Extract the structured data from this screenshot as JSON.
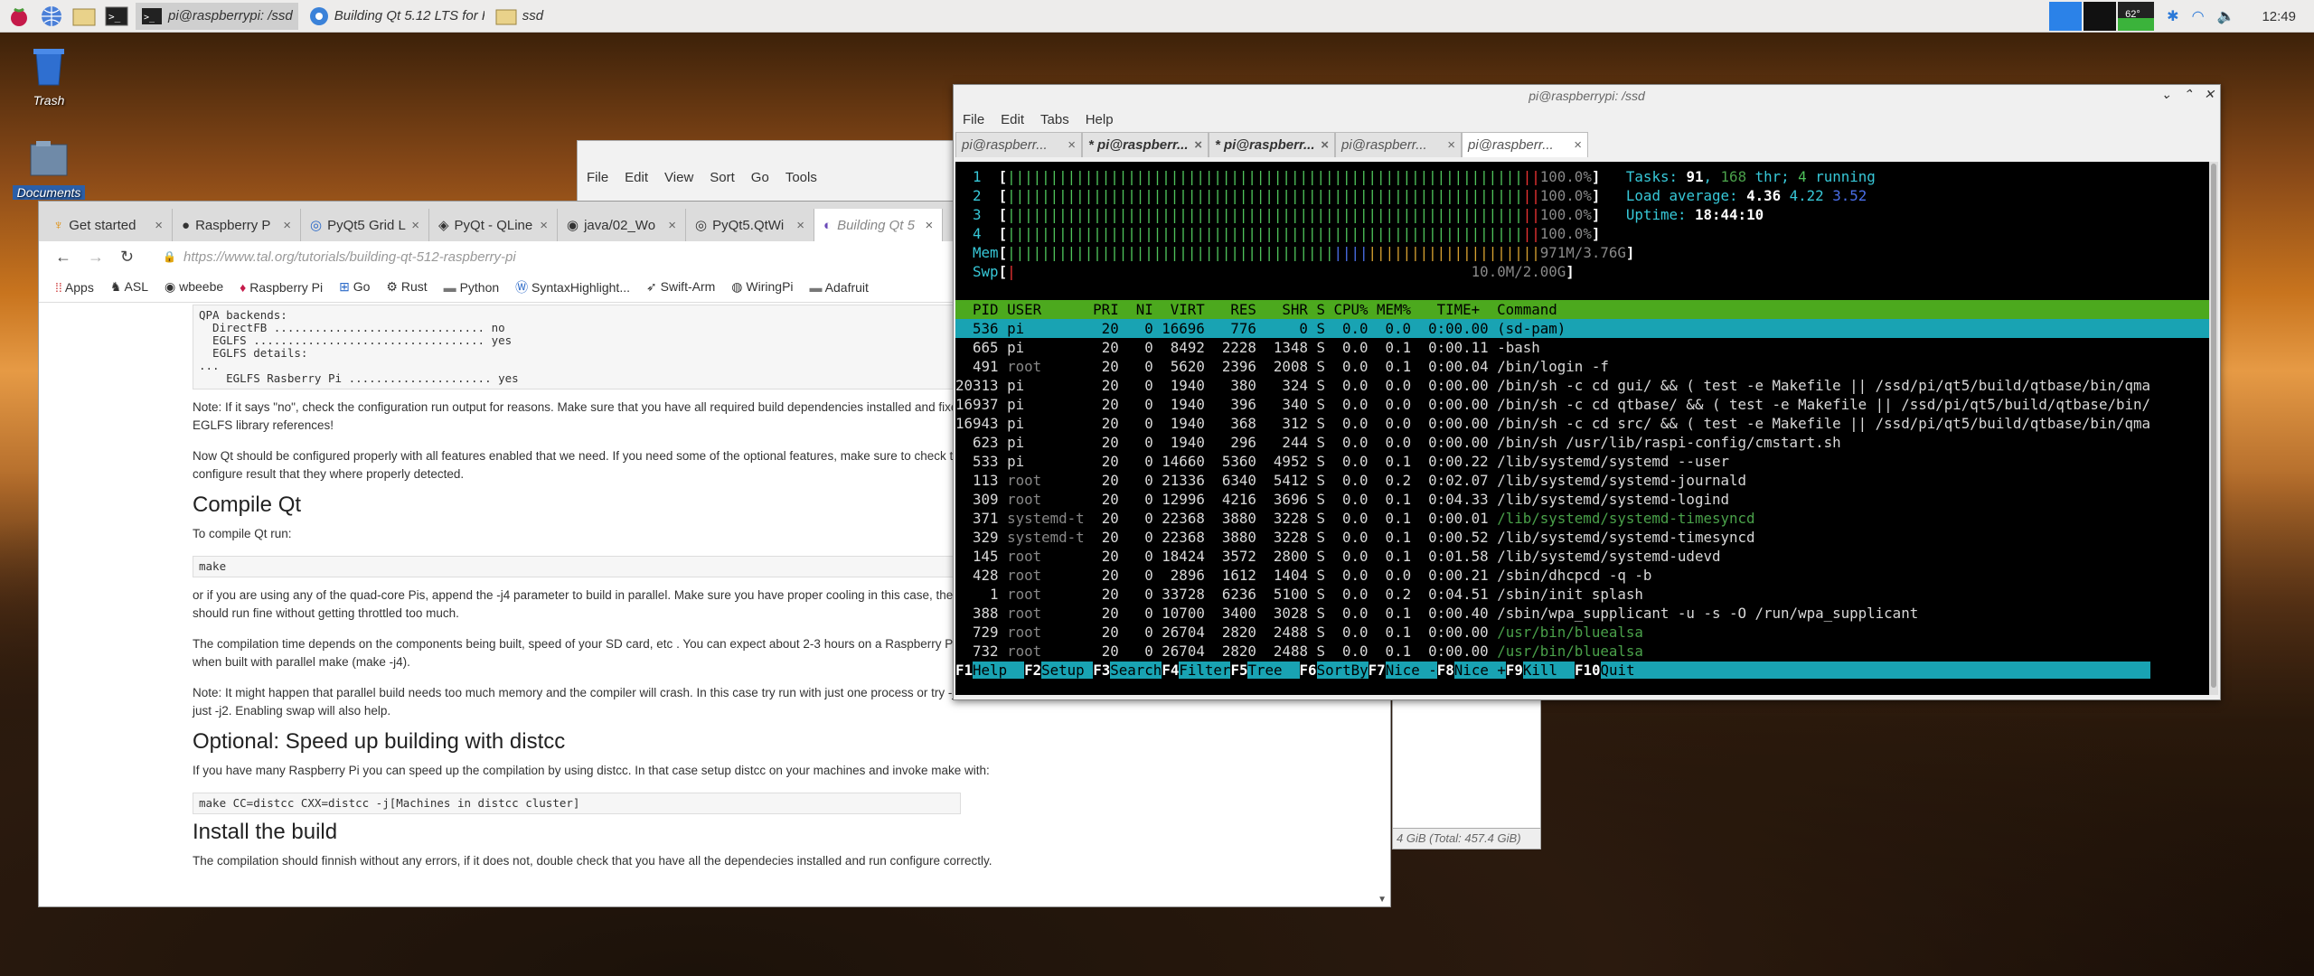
{
  "taskbar": {
    "tasks": [
      {
        "label": "pi@raspberrypi: /ssd",
        "icon": "terminal-icon"
      },
      {
        "label": "Building Qt 5.12 LTS for R...",
        "icon": "chromium-icon"
      },
      {
        "label": "ssd",
        "icon": "folder-icon"
      }
    ],
    "cpu": "62°",
    "clock": "12:49"
  },
  "desktop": {
    "icons": [
      {
        "label": "Trash"
      },
      {
        "label": "Documents"
      }
    ]
  },
  "filemanager": {
    "menu": [
      "File",
      "Edit",
      "View",
      "Sort",
      "Go",
      "Tools"
    ],
    "status": "4 GiB (Total: 457.4 GiB)"
  },
  "browser": {
    "tabs": [
      "Get started",
      "Raspberry P",
      "PyQt5 Grid L",
      "PyQt - QLine",
      "java/02_Wo",
      "PyQt5.QtWi",
      "Building Qt 5"
    ],
    "url": "https://www.tal.org/tutorials/building-qt-512-raspberry-pi",
    "bookmarks": [
      "Apps",
      "ASL",
      "wbeebe",
      "Raspberry Pi",
      "Go",
      "Rust",
      "Python",
      "SyntaxHighlight...",
      "Swift-Arm",
      "WiringPi",
      "Adafruit"
    ],
    "code1": "QPA backends:\n  DirectFB ............................... no\n  EGLFS .................................. yes\n  EGLFS details:\n...\n    EGLFS Rasberry Pi ..................... yes",
    "p1": "Note: If it says \"no\", check the configuration run output for reasons. Make sure that you have all required build dependencies installed and fixed the EGLFS library references!",
    "p2": "Now Qt should be configured properly with all features enabled that we need. If you need some of the optional features, make sure to check the configure result that they where properly detected.",
    "h_compile": "Compile Qt",
    "p3": "To compile Qt run:",
    "code2": "make",
    "p4": "or if you are using any of the quad-core Pis, append the -j4 parameter to build in parallel. Make sure you have proper cooling in this case, the 3+ this should run fine without getting throttled too much.",
    "p5": "The compilation time depends on the components being built, speed of your SD card, etc . You can expect about 2-3 hours on a Raspberry Pi 3 when built with parallel make (make -j4).",
    "p6": "Note: It might happen that parallel build needs too much memory and the compiler will crash. In this case try run with just one process or try -j3 or just -j2. Enabling swap will also help.",
    "h_distcc": "Optional: Speed up building with distcc",
    "p7": "If you have many Raspberry Pi you can speed up the compilation by using distcc. In that case setup distcc on your machines and invoke make with:",
    "code3": "make CC=distcc CXX=distcc -j[Machines in distcc cluster]",
    "h_install": "Install the build",
    "p8": "The compilation should finnish without any errors, if it does not, double check that you have all the dependecies installed and run configure correctly."
  },
  "terminal": {
    "title": "pi@raspberrypi: /ssd",
    "menu": [
      "File",
      "Edit",
      "Tabs",
      "Help"
    ],
    "tabs": [
      "pi@raspberr...",
      "* pi@raspberr...",
      "* pi@raspberr...",
      "pi@raspberr...",
      "pi@raspberr..."
    ],
    "cpu_rows": [
      {
        "n": "1",
        "pct": "100.0%"
      },
      {
        "n": "2",
        "pct": "100.0%"
      },
      {
        "n": "3",
        "pct": "100.0%"
      },
      {
        "n": "4",
        "pct": "100.0%"
      }
    ],
    "mem": "971M/3.76G",
    "swp": "10.0M/2.00G",
    "tasks": "91",
    "thr": "168",
    "running": "4",
    "load": [
      "4.36",
      "4.22",
      "3.52"
    ],
    "uptime": "18:44:10",
    "header": "  PID USER      PRI  NI  VIRT   RES   SHR S CPU% MEM%   TIME+  Command",
    "procs": [
      {
        "pid": "536",
        "user": "pi",
        "virt": "16696",
        "res": "776",
        "shr": "0",
        "cpu": "0.0",
        "mem": "0.0",
        "time": "0:00.00",
        "cmd": "(sd-pam)"
      },
      {
        "pid": "665",
        "user": "pi",
        "virt": "8492",
        "res": "2228",
        "shr": "1348",
        "cpu": "0.0",
        "mem": "0.1",
        "time": "0:00.11",
        "cmd": "-bash"
      },
      {
        "pid": "491",
        "user": "root",
        "virt": "5620",
        "res": "2396",
        "shr": "2008",
        "cpu": "0.0",
        "mem": "0.1",
        "time": "0:00.04",
        "cmd": "/bin/login -f"
      },
      {
        "pid": "20313",
        "user": "pi",
        "virt": "1940",
        "res": "380",
        "shr": "324",
        "cpu": "0.0",
        "mem": "0.0",
        "time": "0:00.00",
        "cmd": "/bin/sh -c cd gui/ && ( test -e Makefile || /ssd/pi/qt5/build/qtbase/bin/qma"
      },
      {
        "pid": "16937",
        "user": "pi",
        "virt": "1940",
        "res": "396",
        "shr": "340",
        "cpu": "0.0",
        "mem": "0.0",
        "time": "0:00.00",
        "cmd": "/bin/sh -c cd qtbase/ && ( test -e Makefile || /ssd/pi/qt5/build/qtbase/bin/"
      },
      {
        "pid": "16943",
        "user": "pi",
        "virt": "1940",
        "res": "368",
        "shr": "312",
        "cpu": "0.0",
        "mem": "0.0",
        "time": "0:00.00",
        "cmd": "/bin/sh -c cd src/ && ( test -e Makefile || /ssd/pi/qt5/build/qtbase/bin/qma"
      },
      {
        "pid": "623",
        "user": "pi",
        "virt": "1940",
        "res": "296",
        "shr": "244",
        "cpu": "0.0",
        "mem": "0.0",
        "time": "0:00.00",
        "cmd": "/bin/sh /usr/lib/raspi-config/cmstart.sh"
      },
      {
        "pid": "533",
        "user": "pi",
        "virt": "14660",
        "res": "5360",
        "shr": "4952",
        "cpu": "0.0",
        "mem": "0.1",
        "time": "0:00.22",
        "cmd": "/lib/systemd/systemd --user"
      },
      {
        "pid": "113",
        "user": "root",
        "virt": "21336",
        "res": "6340",
        "shr": "5412",
        "cpu": "0.0",
        "mem": "0.2",
        "time": "0:02.07",
        "cmd": "/lib/systemd/systemd-journald"
      },
      {
        "pid": "309",
        "user": "root",
        "virt": "12996",
        "res": "4216",
        "shr": "3696",
        "cpu": "0.0",
        "mem": "0.1",
        "time": "0:04.33",
        "cmd": "/lib/systemd/systemd-logind"
      },
      {
        "pid": "371",
        "user": "systemd-t",
        "virt": "22368",
        "res": "3880",
        "shr": "3228",
        "cpu": "0.0",
        "mem": "0.1",
        "time": "0:00.01",
        "cmd": "/lib/systemd/systemd-timesyncd"
      },
      {
        "pid": "329",
        "user": "systemd-t",
        "virt": "22368",
        "res": "3880",
        "shr": "3228",
        "cpu": "0.0",
        "mem": "0.1",
        "time": "0:00.52",
        "cmd": "/lib/systemd/systemd-timesyncd"
      },
      {
        "pid": "145",
        "user": "root",
        "virt": "18424",
        "res": "3572",
        "shr": "2800",
        "cpu": "0.0",
        "mem": "0.1",
        "time": "0:01.58",
        "cmd": "/lib/systemd/systemd-udevd"
      },
      {
        "pid": "428",
        "user": "root",
        "virt": "2896",
        "res": "1612",
        "shr": "1404",
        "cpu": "0.0",
        "mem": "0.0",
        "time": "0:00.21",
        "cmd": "/sbin/dhcpcd -q -b"
      },
      {
        "pid": "1",
        "user": "root",
        "virt": "33728",
        "res": "6236",
        "shr": "5100",
        "cpu": "0.0",
        "mem": "0.2",
        "time": "0:04.51",
        "cmd": "/sbin/init splash"
      },
      {
        "pid": "388",
        "user": "root",
        "virt": "10700",
        "res": "3400",
        "shr": "3028",
        "cpu": "0.0",
        "mem": "0.1",
        "time": "0:00.40",
        "cmd": "/sbin/wpa_supplicant -u -s -O /run/wpa_supplicant"
      },
      {
        "pid": "729",
        "user": "root",
        "virt": "26704",
        "res": "2820",
        "shr": "2488",
        "cpu": "0.0",
        "mem": "0.1",
        "time": "0:00.00",
        "cmd": "/usr/bin/bluealsa"
      },
      {
        "pid": "732",
        "user": "root",
        "virt": "26704",
        "res": "2820",
        "shr": "2488",
        "cpu": "0.0",
        "mem": "0.1",
        "time": "0:00.00",
        "cmd": "/usr/bin/bluealsa"
      }
    ],
    "fkeys": [
      {
        "k": "F1",
        "l": "Help  "
      },
      {
        "k": "F2",
        "l": "Setup "
      },
      {
        "k": "F3",
        "l": "Search"
      },
      {
        "k": "F4",
        "l": "Filter"
      },
      {
        "k": "F5",
        "l": "Tree  "
      },
      {
        "k": "F6",
        "l": "SortBy"
      },
      {
        "k": "F7",
        "l": "Nice -"
      },
      {
        "k": "F8",
        "l": "Nice +"
      },
      {
        "k": "F9",
        "l": "Kill  "
      },
      {
        "k": "F10",
        "l": "Quit"
      }
    ]
  }
}
